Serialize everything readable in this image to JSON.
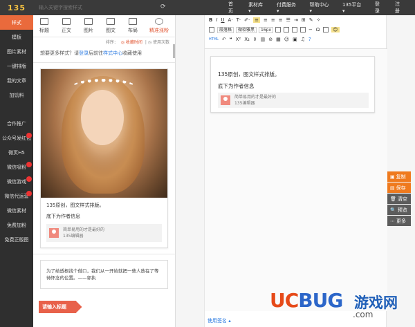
{
  "app": {
    "logo": "135"
  },
  "search": {
    "placeholder": "输入关键字搜索样式"
  },
  "topnav": [
    "首页",
    "素材库 ▾",
    "付费服务 ▾",
    "帮助中心 ▾",
    "135平台 ▾",
    "登录",
    "注册"
  ],
  "sidebar": {
    "items": [
      {
        "label": "样式",
        "active": true
      },
      {
        "label": "模板"
      },
      {
        "label": "图片素材"
      },
      {
        "label": "一键排版"
      },
      {
        "label": "我的文章"
      },
      {
        "label": "加饥料"
      }
    ],
    "items2": [
      {
        "label": "合作推广"
      },
      {
        "label": "公众号发红包",
        "badge": true
      },
      {
        "label": "微页H5"
      },
      {
        "label": "微信吸粉",
        "badge": true
      },
      {
        "label": "微信游戏",
        "badge": true
      },
      {
        "label": "微信代运营",
        "badge": true
      },
      {
        "label": "微信素材"
      },
      {
        "label": "免费加粉"
      },
      {
        "label": "免费正版图"
      }
    ]
  },
  "panel": {
    "tabs": [
      "标题",
      "正文",
      "图片",
      "图文",
      "布局",
      "精准涨粉"
    ],
    "sort": {
      "label": "排序：",
      "hot": "◎ 收藏时间",
      "count": "| ◷ 使用次数"
    },
    "hint": {
      "before": "想要更多样式？请",
      "login": "登录",
      "middle": "后前往",
      "center": "样式中心",
      "after": "收藏使用"
    },
    "card": {
      "line1": "135原创，图文样式排版。",
      "line2": "底下为作者信息",
      "author_line1": "简单易用的才是最好的",
      "author_line2": "135编辑器"
    },
    "quote": "为了给透根找个借口，我们从一开始就把一些人放在了等待怀念的位置。——郭执",
    "title_block": "请输入标题"
  },
  "editor": {
    "row2": {
      "para": "段落格",
      "font": "微软雅黑",
      "size": "16px"
    },
    "card": {
      "line1": "135原创，图文样式排版。",
      "line2": "底下为作者信息",
      "author_line1": "简单易用的才是最好的",
      "author_line2": "135编辑器"
    },
    "status": "使用签名 ▴"
  },
  "actions": [
    {
      "icon": "▣",
      "label": "复制",
      "style": "orange"
    },
    {
      "icon": "▤",
      "label": "保存",
      "style": "orange"
    },
    {
      "icon": "🗑",
      "label": "清空",
      "style": "gray"
    },
    {
      "icon": "🔍",
      "label": "预览",
      "style": "gray"
    },
    {
      "icon": "⋯",
      "label": "更多",
      "style": "gray"
    }
  ],
  "watermark": {
    "uc": "UC",
    "bug": "BUG",
    "cn": "游戏网",
    "com": ".com"
  }
}
